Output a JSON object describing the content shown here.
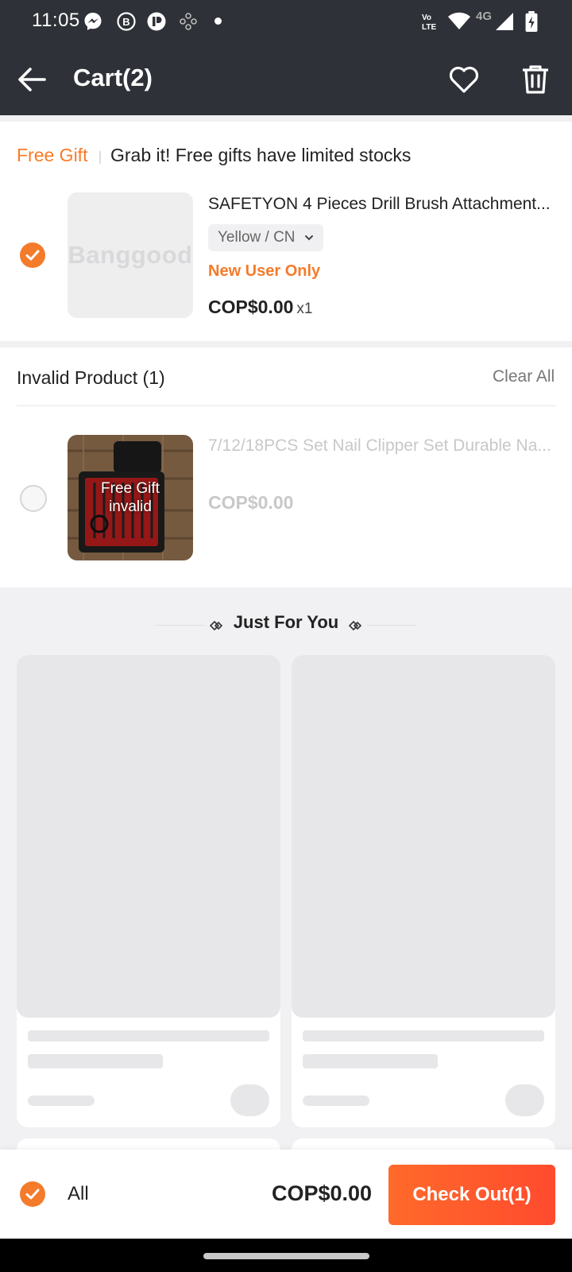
{
  "status_bar": {
    "time": "11:05",
    "network_label": "4G",
    "left_icons": [
      "messenger-icon",
      "b-circle-icon",
      "p-circle-icon",
      "dots-icon",
      "dot-icon"
    ],
    "right_icons": [
      "volte-icon",
      "wifi-icon",
      "signal-icon",
      "battery-icon"
    ]
  },
  "header": {
    "title": "Cart(2)"
  },
  "free_gift": {
    "tag": "Free Gift",
    "message": "Grab it! Free gifts have limited stocks",
    "product": {
      "title": "SAFETYON 4 Pieces Drill Brush Attachment...",
      "image_placeholder": "Banggood",
      "variant": "Yellow / CN",
      "promo": "New User Only",
      "price": "COP$0.00",
      "quantity": "x1",
      "selected": true
    }
  },
  "invalid": {
    "heading": "Invalid Product (1)",
    "clear_label": "Clear All",
    "product": {
      "title": "7/12/18PCS Set Nail Clipper Set Durable Na...",
      "overlay_line1": "Free Gift",
      "overlay_line2": "invalid",
      "price": "COP$0.00",
      "selected": false
    }
  },
  "recommend": {
    "heading": "Just For You"
  },
  "bottom_bar": {
    "all_label": "All",
    "total": "COP$0.00",
    "checkout_label": "Check Out(1)"
  },
  "colors": {
    "accent": "#f47b2a",
    "header_bg": "#2f3138",
    "checkout_gradient_start": "#ff6a2a",
    "checkout_gradient_end": "#ff4b2e"
  }
}
